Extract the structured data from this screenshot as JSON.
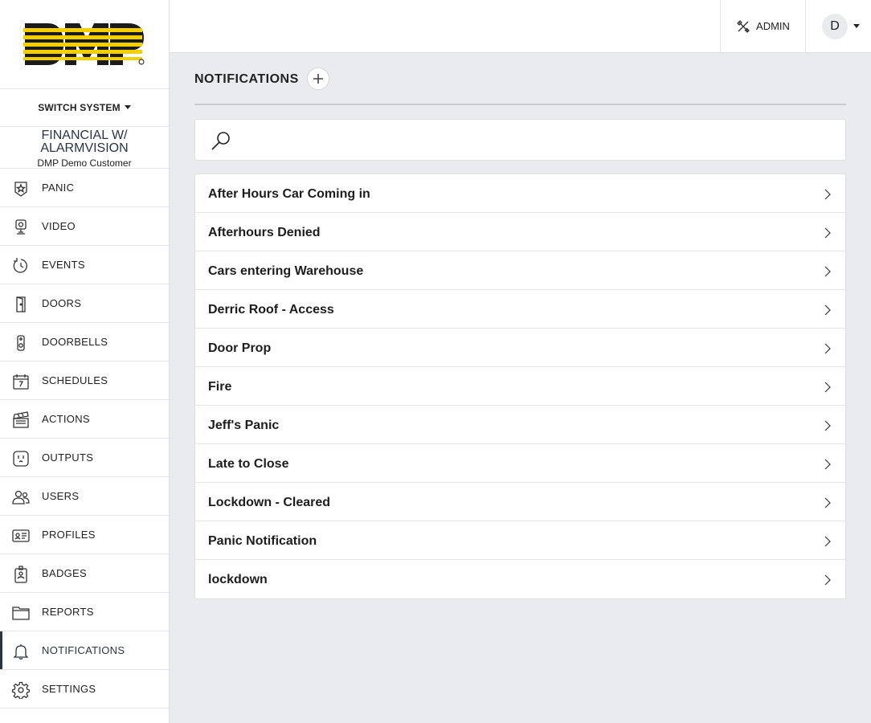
{
  "brand": {
    "logo_text": "DMP",
    "accent": "#f5d000"
  },
  "sidebar": {
    "switch_system_label": "SWITCH SYSTEM",
    "system_name_line1": "FINANCIAL W/",
    "system_name_line2": "ALARMVISION",
    "customer_name": "DMP Demo Customer",
    "items": [
      {
        "label": "PANIC",
        "icon": "panic-icon"
      },
      {
        "label": "VIDEO",
        "icon": "video-icon"
      },
      {
        "label": "EVENTS",
        "icon": "events-icon"
      },
      {
        "label": "DOORS",
        "icon": "door-icon"
      },
      {
        "label": "DOORBELLS",
        "icon": "doorbell-icon"
      },
      {
        "label": "SCHEDULES",
        "icon": "calendar-icon"
      },
      {
        "label": "ACTIONS",
        "icon": "clapperboard-icon"
      },
      {
        "label": "OUTPUTS",
        "icon": "outlet-icon"
      },
      {
        "label": "USERS",
        "icon": "users-icon"
      },
      {
        "label": "PROFILES",
        "icon": "id-card-icon"
      },
      {
        "label": "BADGES",
        "icon": "badge-icon"
      },
      {
        "label": "REPORTS",
        "icon": "folder-icon"
      },
      {
        "label": "NOTIFICATIONS",
        "icon": "bell-icon",
        "active": true
      },
      {
        "label": "SETTINGS",
        "icon": "gear-icon"
      }
    ]
  },
  "topbar": {
    "admin_label": "ADMIN",
    "user_initial": "D"
  },
  "main": {
    "title": "NOTIFICATIONS",
    "search": {
      "placeholder": "",
      "value": ""
    },
    "notifications": [
      "After Hours Car Coming in",
      "Afterhours Denied",
      "Cars entering Warehouse",
      "Derric Roof - Access",
      "Door Prop",
      "Fire",
      "Jeff's Panic",
      "Late to Close",
      "Lockdown - Cleared",
      "Panic Notification",
      "lockdown"
    ]
  }
}
